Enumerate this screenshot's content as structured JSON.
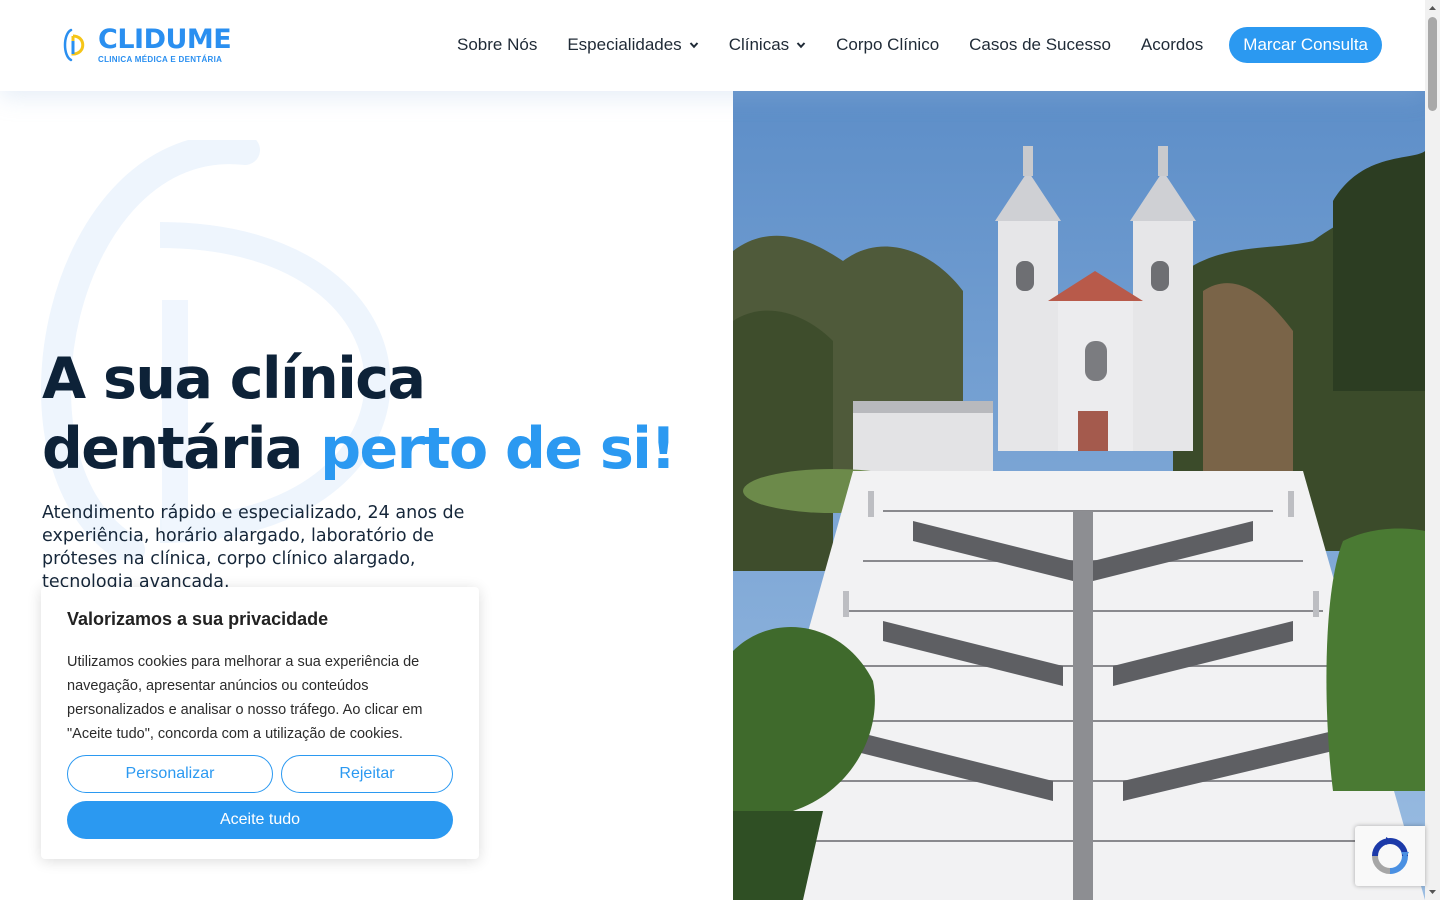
{
  "brand": {
    "name": "CLIDUME",
    "tagline": "CLINICA MÉDICA E DENTÁRIA",
    "colors": {
      "primary": "#2b99f1",
      "logo_blue": "#2a8ff0",
      "logo_yellow": "#f5c518",
      "heading": "#0d2238"
    }
  },
  "nav": {
    "items": [
      {
        "label": "Sobre Nós",
        "has_dropdown": false
      },
      {
        "label": "Especialidades",
        "has_dropdown": true
      },
      {
        "label": "Clínicas",
        "has_dropdown": true
      },
      {
        "label": "Corpo Clínico",
        "has_dropdown": false
      },
      {
        "label": "Casos de Sucesso",
        "has_dropdown": false
      },
      {
        "label": "Acordos",
        "has_dropdown": false
      }
    ],
    "cta": "Marcar Consulta",
    "dropdown_icon": "chevron-down-icon"
  },
  "hero": {
    "title_line1": "A sua clínica",
    "title_line2_plain": "dentária",
    "title_line2_accent": "perto de si!",
    "description": "Atendimento rápido e especializado, 24 anos de experiência, horário alargado, laboratório de próteses na clínica, corpo clínico alargado, tecnologia avançada.",
    "image_subject": "Bom Jesus do Monte sanctuary with baroque staircase"
  },
  "cookie_banner": {
    "title": "Valorizamos a sua privacidade",
    "text": "Utilizamos cookies para melhorar a sua experiência de navegação, apresentar anúncios ou conteúdos personalizados e analisar o nosso tráfego. Ao clicar em \"Aceite tudo\", concorda com a utilização de cookies.",
    "customize": "Personalizar",
    "reject": "Rejeitar",
    "accept_all": "Aceite tudo"
  },
  "recaptcha": {
    "icon": "recaptcha-icon"
  }
}
